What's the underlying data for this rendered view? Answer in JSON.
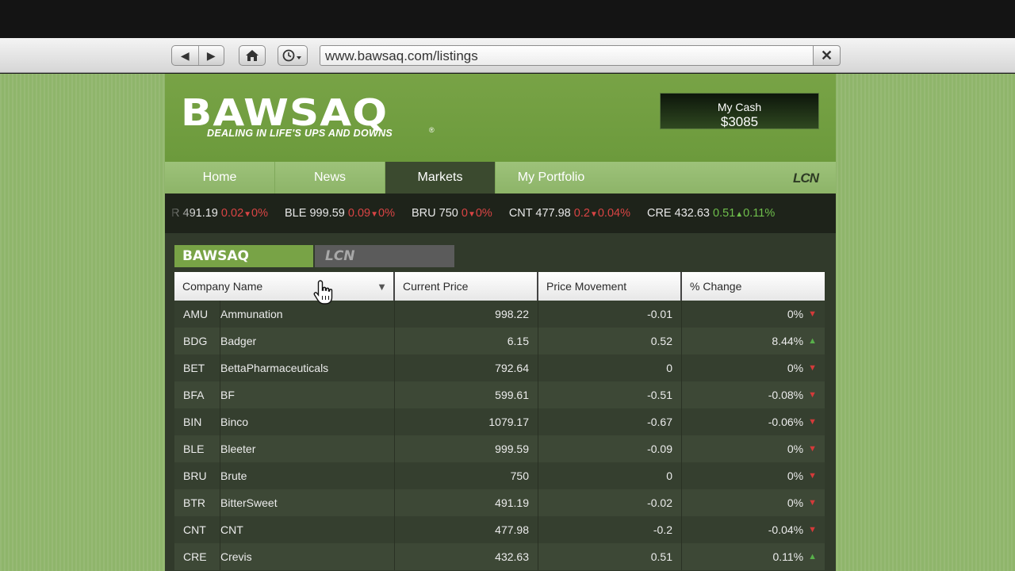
{
  "browser": {
    "back_icon": "◀",
    "forward_icon": "▶",
    "url": "www.bawsaq.com/listings",
    "close_icon": "✕"
  },
  "site": {
    "logo": "BAWSAQ",
    "logo_reg": "®",
    "tagline": "DEALING IN LIFE'S UPS AND DOWNS",
    "cash_label": "My Cash",
    "cash_value": "$3085",
    "nav": [
      "Home",
      "News",
      "Markets",
      "My Portfolio"
    ],
    "nav_active": "Markets",
    "lcn_logo": "LCN"
  },
  "ticker": [
    {
      "sym": "R",
      "price": "491.19",
      "move": "0.02",
      "pct": "0%",
      "dir": "down"
    },
    {
      "sym": "BLE",
      "price": "999.59",
      "move": "0.09",
      "pct": "0%",
      "dir": "down"
    },
    {
      "sym": "BRU",
      "price": "750",
      "move": "0",
      "pct": "0%",
      "dir": "down"
    },
    {
      "sym": "CNT",
      "price": "477.98",
      "move": "0.2",
      "pct": "0.04%",
      "dir": "down"
    },
    {
      "sym": "CRE",
      "price": "432.63",
      "move": "0.51",
      "pct": "0.11%",
      "dir": "up"
    }
  ],
  "exchange_tabs": {
    "bawsaq": "BAWSAQ",
    "lcn": "LCN"
  },
  "table": {
    "headers": [
      "Company Name",
      "Current Price",
      "Price Movement",
      "% Change"
    ],
    "rows": [
      {
        "sym": "AMU",
        "name": "Ammunation",
        "price": "998.22",
        "move": "-0.01",
        "pct": "0%",
        "dir": "down"
      },
      {
        "sym": "BDG",
        "name": "Badger",
        "price": "6.15",
        "move": "0.52",
        "pct": "8.44%",
        "dir": "up"
      },
      {
        "sym": "BET",
        "name": "BettaPharmaceuticals",
        "price": "792.64",
        "move": "0",
        "pct": "0%",
        "dir": "down"
      },
      {
        "sym": "BFA",
        "name": "BF",
        "price": "599.61",
        "move": "-0.51",
        "pct": "-0.08%",
        "dir": "down"
      },
      {
        "sym": "BIN",
        "name": "Binco",
        "price": "1079.17",
        "move": "-0.67",
        "pct": "-0.06%",
        "dir": "down"
      },
      {
        "sym": "BLE",
        "name": "Bleeter",
        "price": "999.59",
        "move": "-0.09",
        "pct": "0%",
        "dir": "down"
      },
      {
        "sym": "BRU",
        "name": "Brute",
        "price": "750",
        "move": "0",
        "pct": "0%",
        "dir": "down"
      },
      {
        "sym": "BTR",
        "name": "BitterSweet",
        "price": "491.19",
        "move": "-0.02",
        "pct": "0%",
        "dir": "down"
      },
      {
        "sym": "CNT",
        "name": "CNT",
        "price": "477.98",
        "move": "-0.2",
        "pct": "-0.04%",
        "dir": "down"
      },
      {
        "sym": "CRE",
        "name": "Crevis",
        "price": "432.63",
        "move": "0.51",
        "pct": "0.11%",
        "dir": "up"
      }
    ]
  },
  "colors": {
    "up": "#58b04a",
    "down": "#d43a3a",
    "brand": "#78a346"
  }
}
